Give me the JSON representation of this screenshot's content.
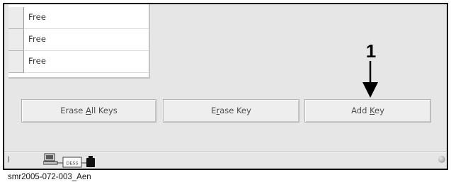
{
  "key_slots": [
    {
      "label": "Free"
    },
    {
      "label": "Free"
    },
    {
      "label": "Free"
    }
  ],
  "buttons": {
    "erase_all_keys": {
      "before": "Erase ",
      "mnemonic": "A",
      "after": "ll Keys"
    },
    "erase_key": {
      "before": "E",
      "mnemonic": "r",
      "after": "ase Key"
    },
    "add_key": {
      "before": "Add ",
      "mnemonic": "K",
      "after": "ey"
    }
  },
  "callout": {
    "number": "1"
  },
  "statusbar": {
    "left_text": ")",
    "icons": [
      "computer-icon",
      "dess-interface-icon",
      "key-device-icon",
      "status-indicator-icon"
    ],
    "dess_label": "DESS"
  },
  "caption": "smr2005-072-003_Aen",
  "colors": {
    "background": "#e6e6e6",
    "list_background": "#ffffff",
    "button_face": "#eeeeee",
    "frame_border": "#000000"
  }
}
